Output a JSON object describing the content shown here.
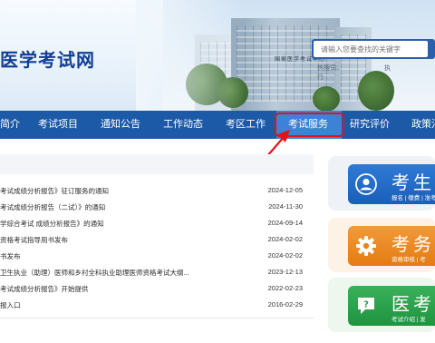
{
  "header": {
    "site_title": "医学考试网",
    "building_sign": "国家医学考试中心",
    "search_placeholder": "请输入您要查找的关键字",
    "hotwords": [
      "热搜词：",
      "执行"
    ]
  },
  "nav": {
    "items": [
      {
        "label": "简介"
      },
      {
        "label": "考试项目"
      },
      {
        "label": "通知公告"
      },
      {
        "label": "工作动态"
      },
      {
        "label": "考区工作"
      },
      {
        "label": "考试服务",
        "active": true
      },
      {
        "label": "研究评价"
      },
      {
        "label": "政策法"
      }
    ]
  },
  "news": [
    {
      "title": "考试成绩分析报告》征订服务的通知",
      "date": "2024-12-05"
    },
    {
      "title": "考试成绩分析报告（二试）》的通知",
      "date": "2024-11-30"
    },
    {
      "title": "学综合考试 成绩分析报告》的通知",
      "date": "2024-09-14"
    },
    {
      "title": "资格考试指导用书发布",
      "date": "2024-02-02"
    },
    {
      "title": "书发布",
      "date": "2024-02-02"
    },
    {
      "title": "卫生执业（助理）医师和乡村全科执业助理医师资格考试大纲...",
      "date": "2023-12-13"
    },
    {
      "title": "考试成绩分析报告》开始提供",
      "date": "2022-02-23"
    },
    {
      "title": "报入口",
      "date": "2016-02-29"
    }
  ],
  "cards": [
    {
      "title": "考生",
      "sub": "报名 | 缴费 | 准考",
      "icon": "user-icon",
      "color": "#1f64bd"
    },
    {
      "title": "考务",
      "sub": "资格审核 | 考",
      "icon": "gear-icon",
      "color": "#ea8520"
    },
    {
      "title": "医考",
      "sub": "考试介绍 | 发",
      "icon": "chat-icon",
      "color": "#2a9d4a"
    }
  ],
  "colors": {
    "nav_bg": "#1c5aa8",
    "nav_active": "#3d82d6",
    "title": "#123f93",
    "highlight": "#e0141b"
  }
}
